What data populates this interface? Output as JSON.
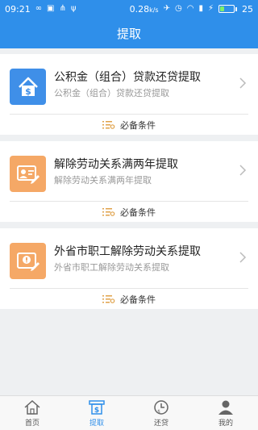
{
  "statusbar": {
    "time": "09:21",
    "speed": "0.28",
    "speed_unit": "k/s",
    "battery": "25"
  },
  "navbar": {
    "title": "提取"
  },
  "cards": [
    {
      "title": "公积金（组合）贷款还贷提取",
      "subtitle": "公积金（组合）贷款还贷提取",
      "condition": "必备条件",
      "icon": "house-dollar-icon",
      "color": "#3f8fe8"
    },
    {
      "title": "解除劳动关系满两年提取",
      "subtitle": "解除劳动关系满两年提取",
      "condition": "必备条件",
      "icon": "id-card-pen-icon",
      "color": "#f5a866"
    },
    {
      "title": "外省市职工解除劳动关系提取",
      "subtitle": "外省市职工解除劳动关系提取",
      "condition": "必备条件",
      "icon": "certificate-icon",
      "color": "#f5a866"
    }
  ],
  "tabbar": {
    "items": [
      {
        "label": "首页",
        "icon": "home-icon"
      },
      {
        "label": "提取",
        "icon": "withdraw-icon",
        "active": true
      },
      {
        "label": "还贷",
        "icon": "repay-clock-icon"
      },
      {
        "label": "我的",
        "icon": "user-icon"
      }
    ]
  },
  "colors": {
    "primary": "#2f8fea",
    "orange": "#f5a866",
    "blue_icon": "#3f8fe8"
  }
}
